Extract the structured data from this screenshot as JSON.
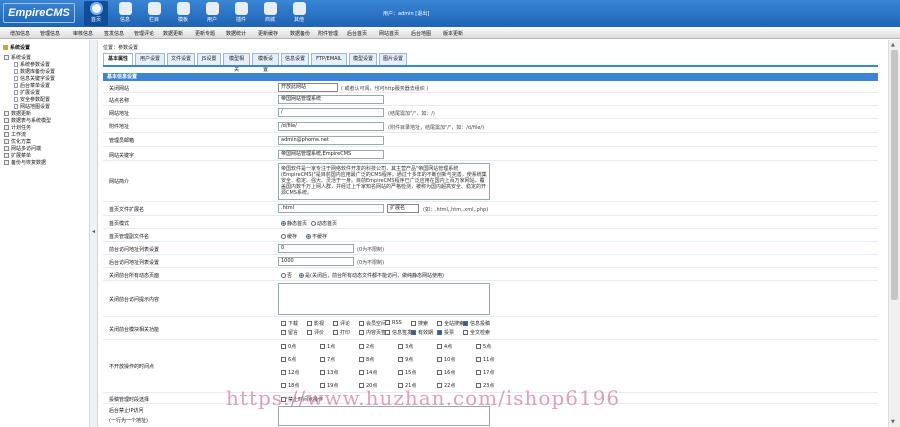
{
  "logo": "EmpireCMS",
  "topnav": [
    {
      "label": "首页",
      "icon": "home-icon"
    },
    {
      "label": "信息",
      "icon": "document-icon"
    },
    {
      "label": "栏目",
      "icon": "folder-icon"
    },
    {
      "label": "模板",
      "icon": "template-icon"
    },
    {
      "label": "用户",
      "icon": "user-icon"
    },
    {
      "label": "插件",
      "icon": "plugin-icon"
    },
    {
      "label": "商城",
      "icon": "shop-icon"
    },
    {
      "label": "其他",
      "icon": "gear-icon"
    }
  ],
  "userinfo": "用户：admin [退出]",
  "subnav": [
    "增加信息",
    "管理信息",
    "审核信息",
    "签发信息",
    "管理评论",
    "数据更新",
    "更新专题",
    "数据统计",
    "更新缓存",
    "数据备份",
    "附件管理",
    "后台首页",
    "网站首页",
    "后台地图",
    "版本更新"
  ],
  "sidebar": {
    "root": "系统设置",
    "items": [
      {
        "label": "系统设置",
        "level": 1
      },
      {
        "label": "系统参数设置",
        "level": 2
      },
      {
        "label": "数据库备份设置",
        "level": 2
      },
      {
        "label": "信息关键字设置",
        "level": 2
      },
      {
        "label": "后台菜单设置",
        "level": 2
      },
      {
        "label": "扩展设置",
        "level": 2
      },
      {
        "label": "安全参数配置",
        "level": 2
      },
      {
        "label": "网站地图设置",
        "level": 2
      },
      {
        "label": "数据更新",
        "level": 1
      },
      {
        "label": "数据表与系统模型",
        "level": 1
      },
      {
        "label": "计划任务",
        "level": 1
      },
      {
        "label": "工作流",
        "level": 1
      },
      {
        "label": "优化方案",
        "level": 1
      },
      {
        "label": "网站多访问端",
        "level": 1
      },
      {
        "label": "扩展菜单",
        "level": 1
      },
      {
        "label": "备份与恢复数据",
        "level": 1
      }
    ]
  },
  "breadcrumb": "位置：参数设置",
  "tabs": [
    "基本属性",
    "用户设置",
    "文件设置",
    "JS设置",
    "模型相关",
    "模板设置",
    "信息设置",
    "FTP/EMAIL",
    "模型设置",
    "图片设置"
  ],
  "form": {
    "section": "基本信息设置",
    "open_label": "关闭网站",
    "open_value": "开放此网站",
    "open_note": "( 或者认可阅，也可http服务器去组织 )",
    "sitename_label": "站点名称",
    "sitename_value": "帝国网站管理系统",
    "siteurl_label": "网站地址",
    "siteurl_value": "/",
    "siteurl_note": "(结尾需加\"/\"，如：/)",
    "newsurl_label": "附件地址",
    "newsurl_value": "/d/file/",
    "newsurl_note": "(附件目录地址，结尾需加\"/\"，如：/d/file/)",
    "email_label": "管理员邮箱",
    "email_value": "admin@phome.net",
    "keywords_label": "网站关键字",
    "keywords_value": "帝国网站管理系统,EmpireCMS",
    "intro_label": "网站简介",
    "intro_value": "帝国软件是一家专注于网络软件开发的科技公司，其主营产品\"帝国网站管理系统(EmpireCMS)\"是目前国内应用最广泛的CMS程序。通过十多年的不断创新与完善，使系统集安全、稳定、强大、灵活于一身。目前EmpireCMS程序已广泛应用在国内上百万家网站，覆盖国内数千万上网人群，并经过上千家知名网站的严格检测，被称为国内超高安全、稳定的开源CMS系统。",
    "index_label": "首页文件扩展名",
    "index_value": ".html",
    "index_select": "扩展名",
    "index_note": "(如：.html,.htm,.xml,.php)",
    "ssl_label": "首页模式",
    "ssl_opt1": "静态首页",
    "ssl_opt2": "动态首页",
    "onefile_label": "首页管理副文件名",
    "onefile_opt1": "缓存",
    "onefile_opt2": "不缓存",
    "maxsize_label": "前台访问地址列表设置",
    "maxsize_value": "0",
    "maxsize_note": "(0为不限制)",
    "cachetime_label": "后台访问地址列表设置",
    "cachetime_value": "1000",
    "cachetime_note": "(0为不限制)",
    "closeenter_label": "关闭前台所有动态页面",
    "closeenter_opt1": "否",
    "closeenter_opt2": "是(关闭后，前台所有动态文件都不能访问，做纯静态网站使用)",
    "closemsg_label": "关闭前台访问提示内容",
    "closemods_label": "关闭前台模块相关功能",
    "mods": [
      {
        "label": "下载",
        "on": false
      },
      {
        "label": "影视",
        "on": false
      },
      {
        "label": "评论",
        "on": false
      },
      {
        "label": "会员空间",
        "on": false
      },
      {
        "label": "RSS",
        "on": false
      },
      {
        "label": "搜索",
        "on": false
      },
      {
        "label": "全站搜索",
        "on": false
      },
      {
        "label": "信息投稿",
        "on": true
      },
      {
        "label": "留言",
        "on": false
      },
      {
        "label": "评价",
        "on": false
      },
      {
        "label": "打印",
        "on": false
      },
      {
        "label": "内容页签",
        "on": false
      },
      {
        "label": "信息签发",
        "on": false
      },
      {
        "label": "有效期",
        "on": true
      },
      {
        "label": "投票",
        "on": true
      },
      {
        "label": "全文检索",
        "on": false
      }
    ],
    "hours_label": "不开放操作的时间点",
    "hours": [
      "0点",
      "1点",
      "2点",
      "3点",
      "4点",
      "5点",
      "6点",
      "7点",
      "8点",
      "9点",
      "10点",
      "11点",
      "12点",
      "13点",
      "14点",
      "15点",
      "16点",
      "17点",
      "18点",
      "19点",
      "20点",
      "21点",
      "22点",
      "23点"
    ],
    "forbid_label": "投稿管理时段选择",
    "forbid_value": "禁止时间点操作",
    "refuse_label": "后台禁止IP访问",
    "refuse_label2": "(一行为一个地址)"
  },
  "watermark": "https://www.huzhan.com/ishop6196"
}
